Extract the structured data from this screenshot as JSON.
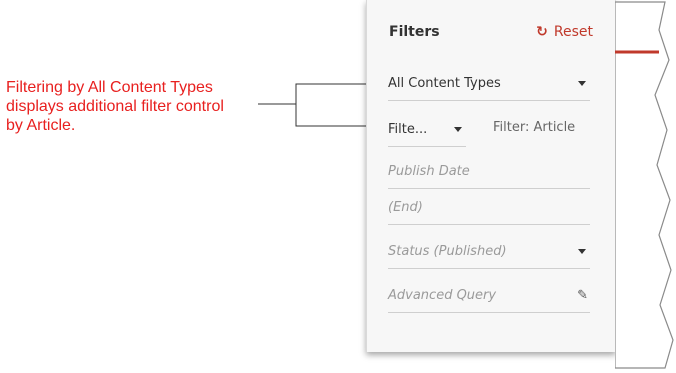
{
  "callout": {
    "line1": "Filtering by All Content Types",
    "line2": "displays additional filter control",
    "line3": "by Article."
  },
  "filters": {
    "title": "Filters",
    "reset_label": "Reset",
    "content_type": "All Content Types",
    "filter_dropdown": "Filte...",
    "filter_label": "Filter: Article",
    "publish_date_placeholder": "Publish Date",
    "end_placeholder": "(End)",
    "status_placeholder": "Status (Published)",
    "advanced_query_placeholder": "Advanced Query"
  },
  "colors": {
    "callout": "#e8201f",
    "accent": "#c0392b"
  }
}
